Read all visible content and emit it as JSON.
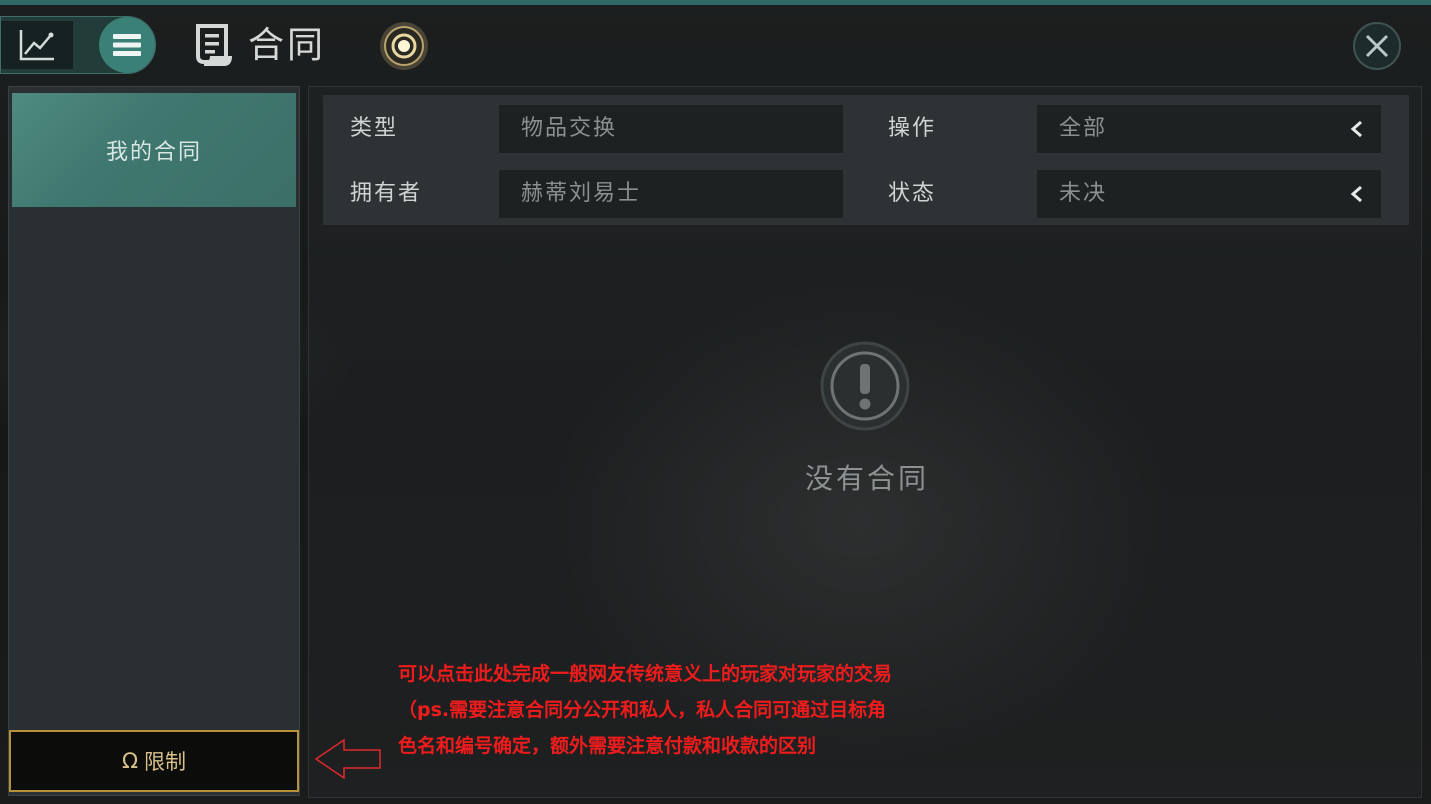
{
  "header": {
    "title": "合同",
    "chart_mode_icon": "line-chart-icon",
    "list_mode_icon": "menu-list-icon",
    "title_icon": "scroll-icon",
    "orb_icon": "glowing-orb-icon",
    "close_icon": "close-icon"
  },
  "sidebar": {
    "tabs": [
      {
        "label": "我的合同",
        "active": true
      }
    ],
    "restrict_button": {
      "icon": "omega-icon",
      "symbol": "Ω",
      "label": "限制"
    }
  },
  "filters": [
    {
      "label": "类型",
      "value": "物品交换",
      "dropdown": false
    },
    {
      "label": "操作",
      "value": "全部",
      "dropdown": true
    },
    {
      "label": "拥有者",
      "value": "赫蒂刘易士",
      "dropdown": false
    },
    {
      "label": "状态",
      "value": "未决",
      "dropdown": true
    }
  ],
  "empty_state": {
    "icon": "exclamation-circle-icon",
    "text": "没有合同"
  },
  "annotation": {
    "lines": [
      "可以点击此处完成一般网友传统意义上的玩家对玩家的交易",
      "（ps.需要注意合同分公开和私人，私人合同可通过目标角",
      "色名和编号确定，额外需要注意付款和收款的区别"
    ],
    "color": "#ee1c1c",
    "arrow_icon": "left-arrow-outline-icon"
  },
  "colors": {
    "accent_teal": "#3a8076",
    "restrict_gold": "#b8913a"
  }
}
